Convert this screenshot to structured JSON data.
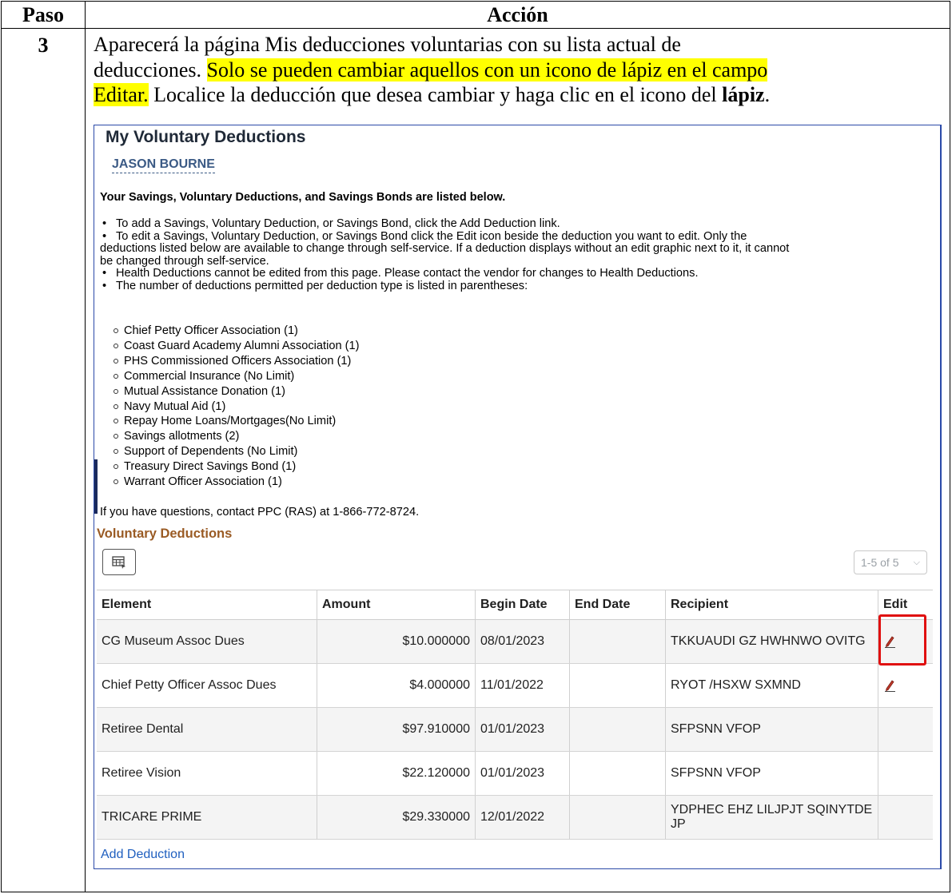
{
  "table_header": {
    "paso": "Paso",
    "accion": "Acción"
  },
  "step": {
    "number": "3",
    "line1": "Aparecerá la página Mis deducciones voluntarias con su lista actual de",
    "line2a": "deducciones.  ",
    "line2b": "Solo se pueden cambiar aquellos con un icono de lápiz en el campo",
    "line3a": "Editar.",
    "line3b": " Localice la deducción que desea cambiar y haga clic en el icono del ",
    "line3c": "lápiz",
    "line3d": "."
  },
  "screen": {
    "title": "My Voluntary Deductions",
    "employee_name": "JASON BOURNE",
    "intro": "Your Savings, Voluntary Deductions, and Savings Bonds are listed below.",
    "bullets": [
      "To add a Savings, Voluntary Deduction, or Savings Bond, click the Add Deduction link.",
      "To edit a Savings, Voluntary Deduction, or Savings Bond click the Edit icon beside the deduction you want to edit. Only the",
      "deductions listed below are available to change through self-service. If a deduction displays without an edit graphic next to it, it cannot",
      "be changed through self-service.",
      "Health Deductions cannot be edited from this page. Please contact the vendor for changes to Health Deductions.",
      "The number of deductions permitted per deduction type is listed in parentheses:"
    ],
    "deduction_types": [
      "Chief Petty Officer Association (1)",
      "Coast Guard Academy Alumni Association (1)",
      "PHS Commissioned Officers Association (1)",
      "Commercial Insurance (No Limit)",
      "Mutual Assistance Donation (1)",
      "Navy Mutual Aid (1)",
      "Repay Home Loans/Mortgages(No Limit)",
      "Savings allotments (2)",
      "Support of Dependents (No Limit)",
      "Treasury Direct Savings Bond (1)",
      "Warrant Officer Association (1)"
    ],
    "contact": "If you have questions, contact PPC (RAS) at 1-866-772-8724.",
    "section_title": "Voluntary Deductions",
    "pager": "1-5 of 5",
    "columns": [
      "Element",
      "Amount",
      "Begin Date",
      "End Date",
      "Recipient",
      "Edit"
    ],
    "rows": [
      {
        "element": "CG Museum Assoc Dues",
        "amount": "$10.000000",
        "begin": "08/01/2023",
        "end": "",
        "recipient": "TKKUAUDI GZ HWHNWO OVITG",
        "editable": true
      },
      {
        "element": "Chief Petty Officer Assoc Dues",
        "amount": "$4.000000",
        "begin": "11/01/2022",
        "end": "",
        "recipient": "RYOT /HSXW SXMND",
        "editable": true
      },
      {
        "element": "Retiree Dental",
        "amount": "$97.910000",
        "begin": "01/01/2023",
        "end": "",
        "recipient": "SFPSNN VFOP",
        "editable": false
      },
      {
        "element": "Retiree Vision",
        "amount": "$22.120000",
        "begin": "01/01/2023",
        "end": "",
        "recipient": "SFPSNN VFOP",
        "editable": false
      },
      {
        "element": "TRICARE PRIME",
        "amount": "$29.330000",
        "begin": "12/01/2022",
        "end": "",
        "recipient": "YDPHEC EHZ LILJPJT SQINYTDE JP",
        "editable": false
      }
    ],
    "add_link": "Add Deduction",
    "colors": {
      "highlight": "#ffff00",
      "callout": "#e01010",
      "section": "#9a5b24",
      "link": "#1f5fbf"
    }
  }
}
